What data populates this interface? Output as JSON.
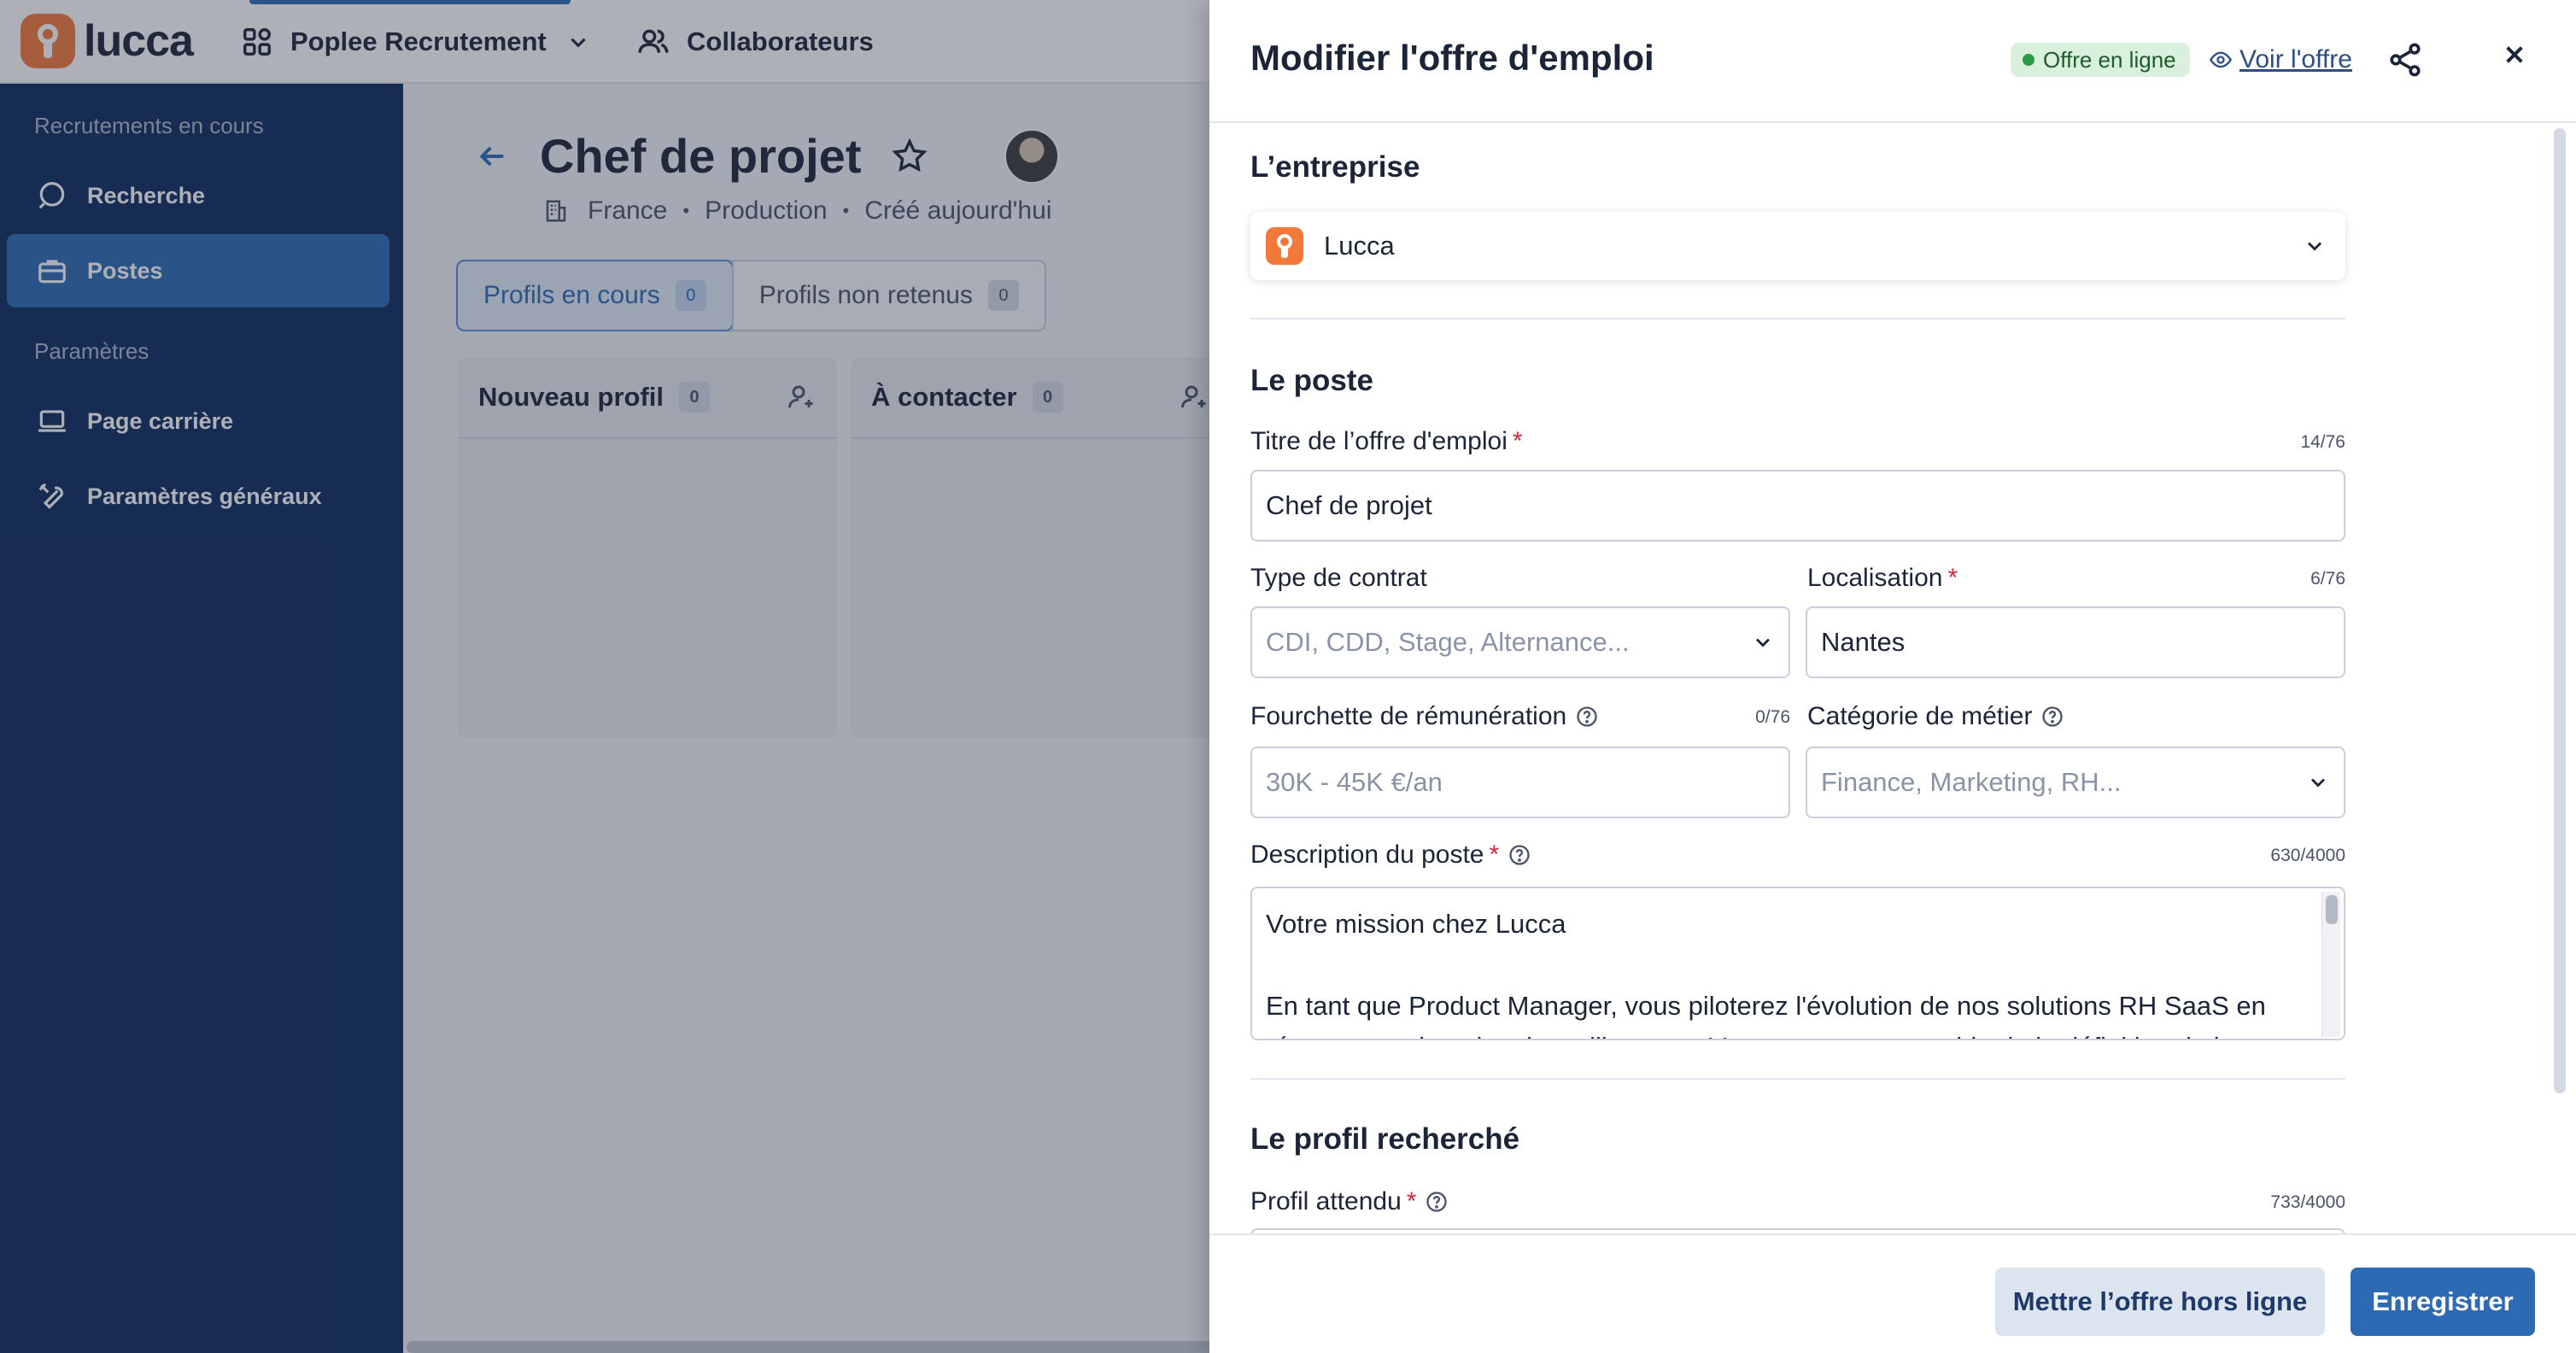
{
  "app": {
    "logo_text": "lucca",
    "module_name": "Poplee Recrutement",
    "collaborators_label": "Collaborateurs"
  },
  "sidebar": {
    "section_recruitments": "Recrutements en cours",
    "section_settings": "Paramètres",
    "items": [
      {
        "label": "Recherche",
        "icon": "search-icon"
      },
      {
        "label": "Postes",
        "icon": "briefcase-icon",
        "active": true
      },
      {
        "label": "Page carrière",
        "icon": "laptop-icon"
      },
      {
        "label": "Paramètres généraux",
        "icon": "tools-icon"
      }
    ]
  },
  "job": {
    "title": "Chef de projet",
    "country": "France",
    "department": "Production",
    "created": "Créé aujourd'hui",
    "tabs": [
      {
        "label": "Profils en cours",
        "count": "0",
        "active": true
      },
      {
        "label": "Profils non retenus",
        "count": "0"
      }
    ],
    "columns": [
      {
        "label": "Nouveau profil",
        "count": "0"
      },
      {
        "label": "À contacter",
        "count": "0"
      }
    ]
  },
  "panel": {
    "title": "Modifier l'offre d'emploi",
    "status_badge": "Offre en ligne",
    "status_color": "#2b9a45",
    "view_link": "Voir l'offre",
    "company_section": "L’entreprise",
    "company_value": "Lucca",
    "position_section": "Le poste",
    "fields": {
      "title": {
        "label": "Titre de l’offre d'emploi",
        "counter": "14/76",
        "value": "Chef de projet"
      },
      "contract": {
        "label": "Type de contrat",
        "placeholder": "CDI, CDD, Stage, Alternance..."
      },
      "location": {
        "label": "Localisation",
        "counter": "6/76",
        "value": "Nantes"
      },
      "salary": {
        "label": "Fourchette de rémunération",
        "counter": "0/76",
        "placeholder": "30K - 45K €/an"
      },
      "category": {
        "label": "Catégorie de métier",
        "placeholder": "Finance, Marketing, RH..."
      },
      "description": {
        "label": "Description du poste",
        "counter": "630/4000",
        "line1": "Votre mission chez Lucca",
        "line2": "En tant que Product Manager, vous piloterez l'évolution de nos solutions RH SaaS en",
        "line3": "réponse aux besoins des utilisateurs. Vous serez responsable de la définition de la"
      }
    },
    "profile_section": "Le profil recherché",
    "expected_profile": {
      "label": "Profil attendu",
      "counter": "733/4000"
    },
    "buttons": {
      "offline": "Mettre l’offre hors ligne",
      "save": "Enregistrer"
    }
  },
  "colors": {
    "primary": "#2c6ab3",
    "sidebar": "#0e2a5e",
    "brand": "#f3793b",
    "required": "#d4283b"
  }
}
